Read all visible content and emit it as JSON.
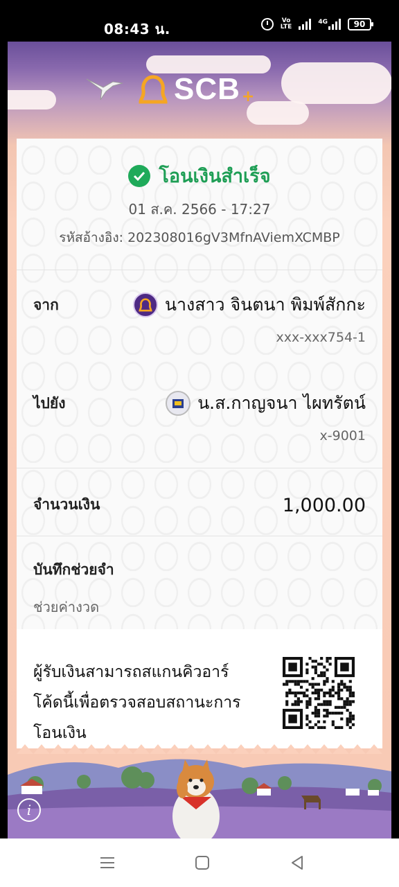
{
  "status_bar": {
    "time": "08:43 น.",
    "volte_top": "Vo",
    "volte_bottom": "LTE",
    "network": "4G",
    "battery": "90"
  },
  "brand": {
    "name": "SCB",
    "plus": "+"
  },
  "transfer": {
    "title": "โอนเงินสำเร็จ",
    "datetime": "01 ส.ค. 2566 - 17:27",
    "reference_label": "รหัสอ้างอิง:",
    "reference_value": "202308016gV3MfnAViemXCMBP"
  },
  "from": {
    "label": "จาก",
    "name": "นางสาว จินตนา พิมพ์สักกะ",
    "account": "xxx-xxx754-1"
  },
  "to": {
    "label": "ไปยัง",
    "name": "น.ส.กาญจนา ไผทรัตน์",
    "account": "x-9001"
  },
  "amount": {
    "label": "จำนวนเงิน",
    "value": "1,000.00"
  },
  "memo": {
    "label": "บันทึกช่วยจำ",
    "value": "ช่วยค่างวด"
  },
  "qr": {
    "line1": "ผู้รับเงินสามารถสแกนคิวอาร์",
    "line2": "โค้ดนี้เพื่อตรวจสอบสถานะการ",
    "line3": "โอนเงิน"
  },
  "info_button_label": "i",
  "colors": {
    "success": "#1e9e55",
    "scb_purple": "#4e2a84",
    "scb_gold": "#f5a623"
  }
}
